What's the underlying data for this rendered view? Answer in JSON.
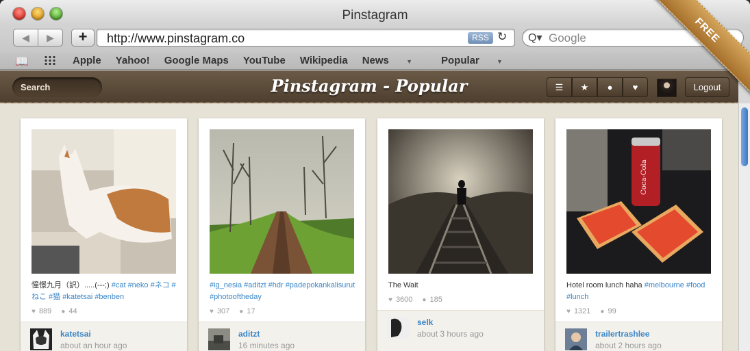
{
  "window": {
    "title": "Pinstagram"
  },
  "toolbar": {
    "back": "◀",
    "forward": "▶",
    "add": "+",
    "url": "http://www.pinstagram.co",
    "rss": "RSS",
    "reload": "↻",
    "search_placeholder": "Google"
  },
  "bookmarks": {
    "items": [
      "Apple",
      "Yahoo!",
      "Google Maps",
      "YouTube",
      "Wikipedia",
      "News",
      "Popular"
    ]
  },
  "ribbon": "FREE",
  "app": {
    "search_label": "Search",
    "title": "Pinstagram - Popular",
    "logout": "Logout"
  },
  "cards": [
    {
      "caption_plain": "憧憬九月（訳）.....(-‐-;)",
      "caption_tags": "#cat #neko #ネコ #ねこ #猫 #katetsai #benben",
      "likes": "889",
      "comments": "44",
      "user": "katetsai",
      "time": "about an hour ago"
    },
    {
      "caption_plain": "",
      "caption_tags": "#ig_nesia #aditzt #hdr #padepokankalisurut #photooftheday",
      "likes": "307",
      "comments": "17",
      "user": "aditzt",
      "time": "16 minutes ago"
    },
    {
      "caption_plain": "The Wait",
      "caption_tags": "",
      "likes": "3600",
      "comments": "185",
      "user": "selk",
      "time": "about 3 hours ago"
    },
    {
      "caption_plain": "Hotel room lunch haha",
      "caption_tags": "#melbourne #food #lunch",
      "likes": "1321",
      "comments": "99",
      "user": "trailertrashlee",
      "time": "about 2 hours ago"
    }
  ],
  "colors": {
    "accent": "#3a86c7",
    "header": "#5a4938"
  }
}
